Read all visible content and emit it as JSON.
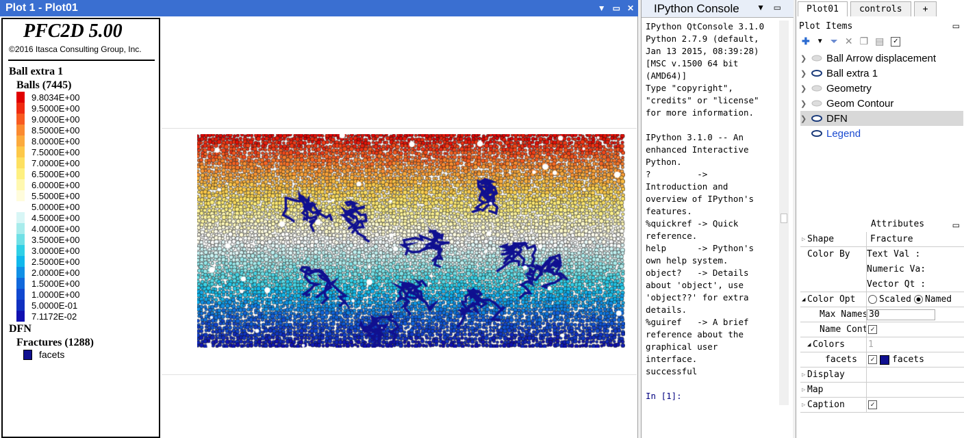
{
  "plot_window": {
    "title": "Plot 1 - Plot01",
    "buttons": [
      "▼",
      "▭",
      "✕"
    ]
  },
  "legend": {
    "brand": "PFC2D 5.00",
    "copyright": "©2016 Itasca Consulting Group, Inc.",
    "heading": "Ball extra 1",
    "balls_label": "Balls (7445)",
    "scale": [
      {
        "value": "9.8034E+00",
        "color": "#e00000"
      },
      {
        "value": "9.5000E+00",
        "color": "#ef2a10"
      },
      {
        "value": "9.0000E+00",
        "color": "#f85a20"
      },
      {
        "value": "8.5000E+00",
        "color": "#fb8a30"
      },
      {
        "value": "8.0000E+00",
        "color": "#fcaa3c"
      },
      {
        "value": "7.5000E+00",
        "color": "#fdc848"
      },
      {
        "value": "7.0000E+00",
        "color": "#fde060"
      },
      {
        "value": "6.5000E+00",
        "color": "#fef080"
      },
      {
        "value": "6.0000E+00",
        "color": "#fff8b0"
      },
      {
        "value": "5.5000E+00",
        "color": "#fffcdc"
      },
      {
        "value": "5.0000E+00",
        "color": "#ffffff"
      },
      {
        "value": "4.5000E+00",
        "color": "#d8f6f6"
      },
      {
        "value": "4.0000E+00",
        "color": "#a8ecec"
      },
      {
        "value": "3.5000E+00",
        "color": "#70e0e6"
      },
      {
        "value": "3.0000E+00",
        "color": "#30d0e6"
      },
      {
        "value": "2.5000E+00",
        "color": "#10b8ec"
      },
      {
        "value": "2.0000E+00",
        "color": "#1090e6"
      },
      {
        "value": "1.5000E+00",
        "color": "#1068dc"
      },
      {
        "value": "1.0000E+00",
        "color": "#1048d0"
      },
      {
        "value": "5.0000E-01",
        "color": "#1030c0"
      },
      {
        "value": "7.1172E-02",
        "color": "#1010b0"
      }
    ],
    "dfn_label": "DFN",
    "fractures_label": "Fractures (1288)",
    "facets_label": "facets",
    "facets_color": "#101090"
  },
  "console": {
    "title": "IPython Console",
    "lines": [
      "IPython QtConsole 3.1.0",
      "Python 2.7.9 (default,",
      "Jan 13 2015, 08:39:28)",
      "[MSC v.1500 64 bit",
      "(AMD64)]",
      "Type \"copyright\",",
      "\"credits\" or \"license\"",
      "for more information.",
      "",
      "IPython 3.1.0 -- An",
      "enhanced Interactive",
      "Python.",
      "?         ->",
      "Introduction and",
      "overview of IPython's",
      "features.",
      "%quickref -> Quick",
      "reference.",
      "help      -> Python's",
      "own help system.",
      "object?   -> Details",
      "about 'object', use",
      "'object??' for extra",
      "details.",
      "%guiref   -> A brief",
      "reference about the",
      "graphical user",
      "interface.",
      "successful",
      ""
    ],
    "prompt": "In [1]:"
  },
  "right_panel": {
    "tabs": [
      "Plot01",
      "controls",
      "+"
    ],
    "plot_items_label": "Plot Items",
    "items": [
      {
        "label": "Ball Arrow displacement",
        "eye": "hidden"
      },
      {
        "label": "Ball extra 1",
        "eye": "visible"
      },
      {
        "label": "Geometry",
        "eye": "hidden"
      },
      {
        "label": "Geom Contour",
        "eye": "hidden"
      },
      {
        "label": "DFN",
        "eye": "visible",
        "selected": true
      },
      {
        "label": "Legend",
        "eye": "visible",
        "link": true
      }
    ],
    "attributes_label": "Attributes",
    "attributes": {
      "shape_k": "Shape",
      "shape_v": "Fracture",
      "colorby_k": "Color By",
      "colorby_text": "Text Val    :",
      "colorby_numeric": "Numeric Va:",
      "colorby_vector": "Vector Qt  :",
      "coloropt_k": "Color Opt",
      "scaled_label": "Scaled",
      "named_label": "Named",
      "maxnames_k": "Max Names",
      "maxnames_v": "30",
      "namecont_k": "Name Cont",
      "colors_k": "Colors",
      "colors_v": "1",
      "facets_k": "facets",
      "facets_v": "facets",
      "display_k": "Display",
      "map_k": "Map",
      "caption_k": "Caption"
    }
  }
}
